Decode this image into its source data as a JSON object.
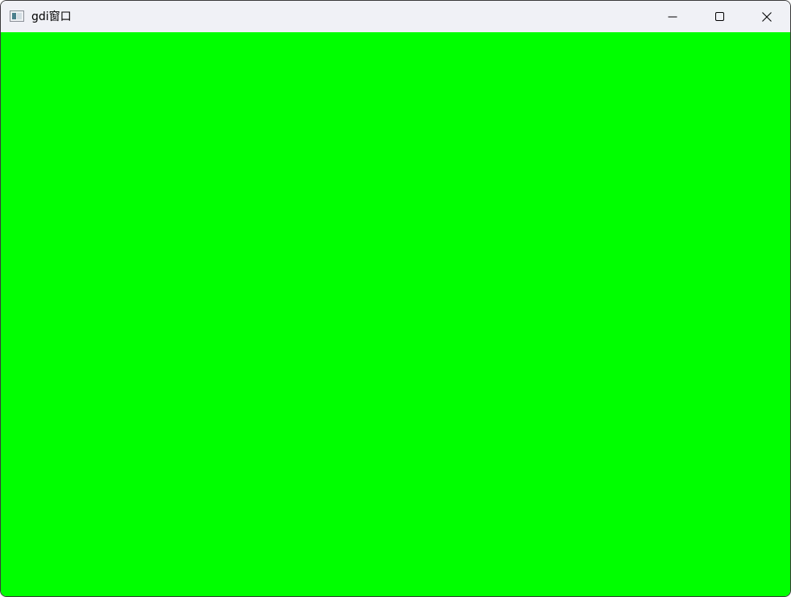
{
  "window": {
    "title": "gdi窗口",
    "client_color": "#00ff00"
  },
  "titlebar": {
    "icon": "app-window-icon",
    "buttons": [
      {
        "name": "minimize",
        "icon": "minimize-icon"
      },
      {
        "name": "maximize",
        "icon": "maximize-icon"
      },
      {
        "name": "close",
        "icon": "close-icon"
      }
    ]
  }
}
